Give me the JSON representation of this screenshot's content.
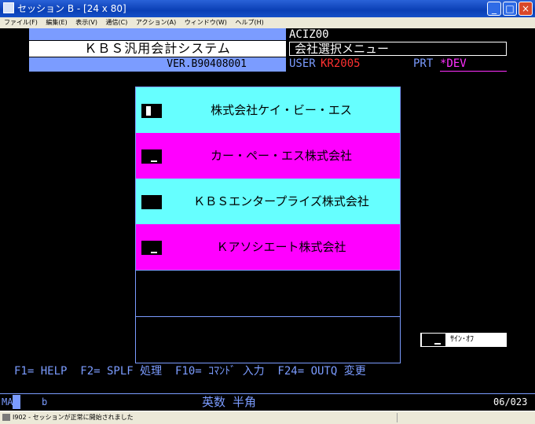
{
  "window": {
    "title": "セッション B - [24 x 80]",
    "buttons": {
      "minimize": "_",
      "maximize": "□",
      "close": "×"
    }
  },
  "menubar": [
    "ファイル(F)",
    "編集(E)",
    "表示(V)",
    "通信(C)",
    "アクション(A)",
    "ウィンドウ(W)",
    "ヘルプ(H)"
  ],
  "header": {
    "system_name": "ＫＢＳ汎用会計システム",
    "version": "VER.B90408001",
    "program_id": "ACIZ00",
    "menu_title": "会社選択メニュー",
    "user_label": "USER",
    "user_value": "KR2005",
    "printer_label": "PRT",
    "printer_value": "*DEV"
  },
  "companies": [
    {
      "name": "株式会社ケイ・ビー・エス",
      "color": "#66ffff"
    },
    {
      "name": "カー・ペー・エス株式会社",
      "color": "#ff00ff"
    },
    {
      "name": "ＫＢＳエンタープライズ株式会社",
      "color": "#66ffff"
    },
    {
      "name": "Ｋアソシエート株式会社",
      "color": "#ff00ff"
    }
  ],
  "signoff": {
    "label": "ｻｲﾝ･ｵﾌ"
  },
  "function_keys": "F1= HELP  F2= SPLF 処理  F10= ｺﾏﾝﾄﾞ 入力  F24= OUTQ 変更",
  "oia": {
    "status": "MA",
    "indicator": "b",
    "input_mode": "英数 半角",
    "cursor_position": "06/023"
  },
  "statusbar": {
    "message": "I902 - セッションが正常に開始されました"
  }
}
